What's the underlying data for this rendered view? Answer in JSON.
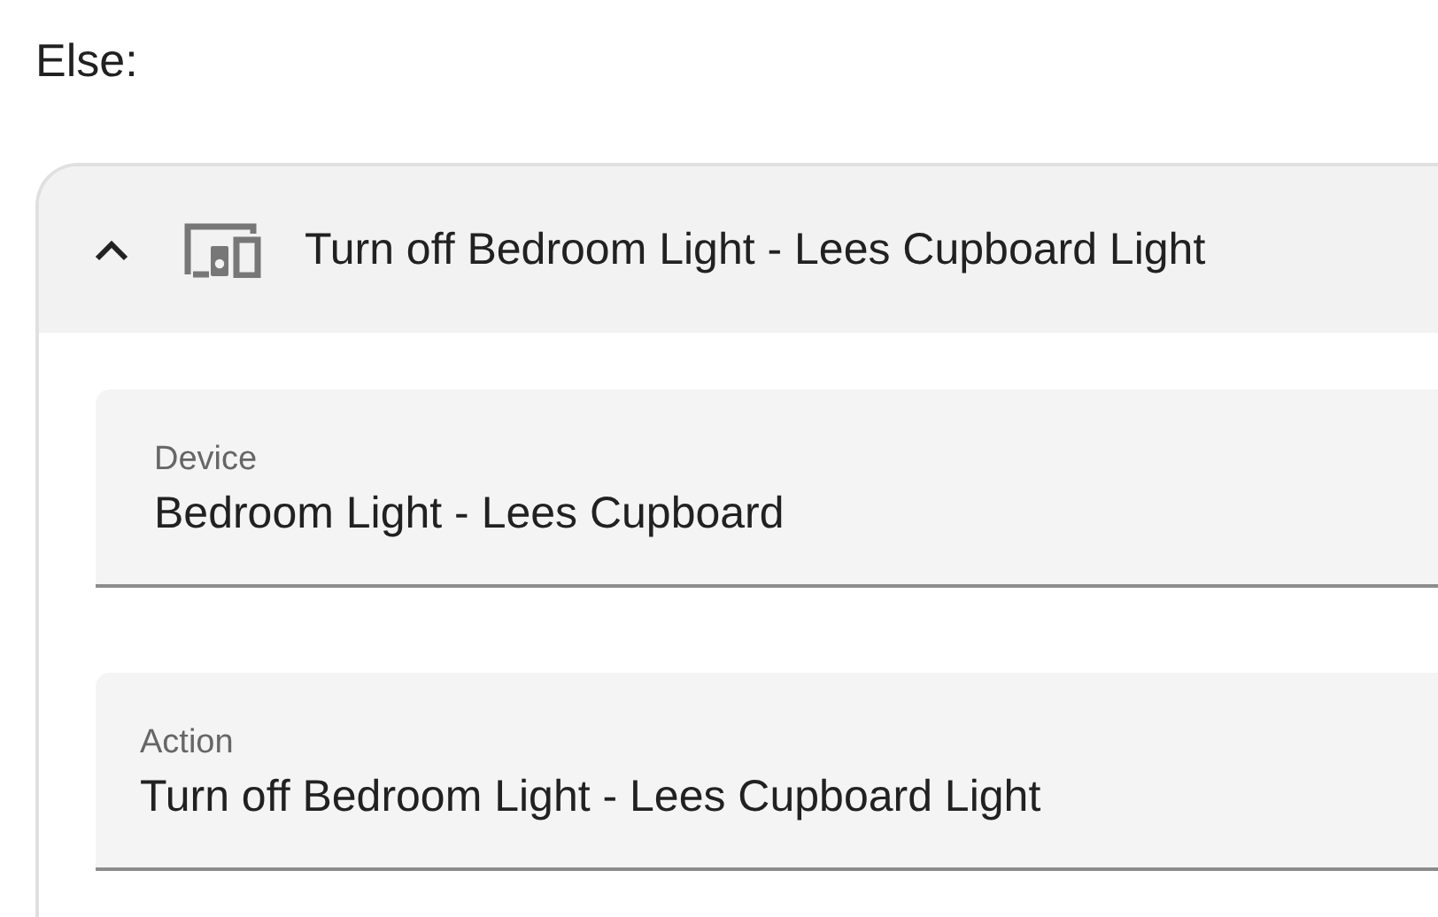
{
  "section_label": "Else:",
  "action_card": {
    "title": "Turn off Bedroom Light - Lees Cupboard Light",
    "expanded": true,
    "fields": [
      {
        "label": "Device",
        "value": "Bedroom Light - Lees Cupboard"
      },
      {
        "label": "Action",
        "value": "Turn off Bedroom Light - Lees Cupboard Light"
      }
    ]
  }
}
